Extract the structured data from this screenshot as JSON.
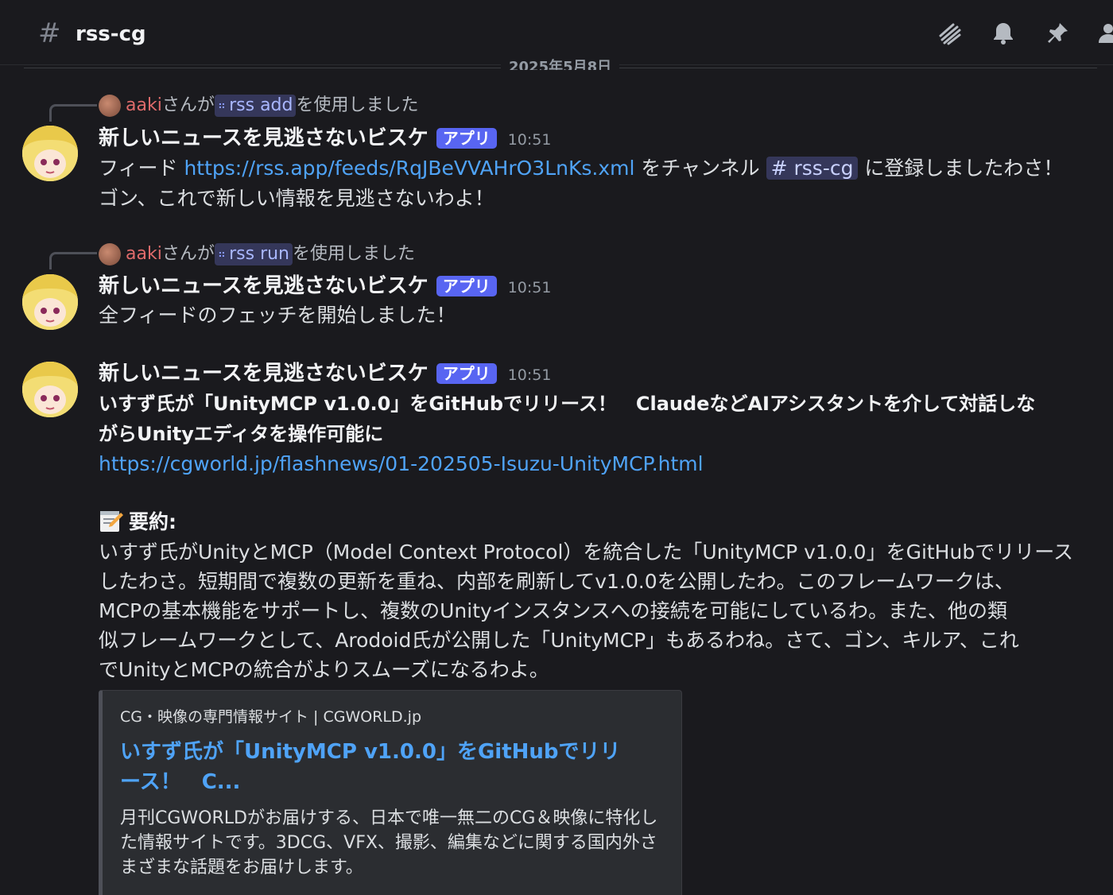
{
  "header": {
    "channel_prefix": "#",
    "channel_name": "rss-cg",
    "icons": [
      "threads-icon",
      "bell-icon",
      "pin-icon",
      "members-icon"
    ]
  },
  "date_divider": "2025年5月8日",
  "messages": [
    {
      "reply": {
        "user": "aaki",
        "middle": "さんが",
        "command": "rss add",
        "suffix": "を使用しました"
      },
      "author": "新しいニュースを見逃さないビスケ",
      "badge": "アプリ",
      "time": "10:51",
      "line1_pre": "フィード ",
      "line1_link": "https://rss.app/feeds/RqJBeVVAHrO3LnKs.xml",
      "line1_mid": " をチャンネル ",
      "line1_channel": "# rss-cg",
      "line1_post": " に登録しましたわさ！",
      "line2": "ゴン、これで新しい情報を見逃さないわよ！"
    },
    {
      "reply": {
        "user": "aaki",
        "middle": "さんが",
        "command": "rss run",
        "suffix": "を使用しました"
      },
      "author": "新しいニュースを見逃さないビスケ",
      "badge": "アプリ",
      "time": "10:51",
      "line1": "全フィードのフェッチを開始しました！"
    },
    {
      "author": "新しいニュースを見逃さないビスケ",
      "badge": "アプリ",
      "time": "10:51",
      "headline_l1": "いすず氏が「UnityMCP v1.0.0」をGitHubでリリース！　ClaudeなどAIアシスタントを介して対話しな",
      "headline_l2": "がらUnityエディタを操作可能に",
      "url": "https://cgworld.jp/flashnews/01-202505-Isuzu-UnityMCP.html",
      "summary_label": "要約:",
      "summary_lines": [
        "いすず氏がUnityとMCP（Model Context Protocol）を統合した「UnityMCP v1.0.0」をGitHubでリリース",
        "したわさ。短期間で複数の更新を重ね、内部を刷新してv1.0.0を公開したわ。このフレームワークは、",
        "MCPの基本機能をサポートし、複数のUnityインスタンスへの接続を可能にしているわ。また、他の類",
        "似フレームワークとして、Arodoid氏が公開した「UnityMCP」もあるわね。さて、ゴン、キルア、これ",
        "でUnityとMCPの統合がよりスムーズになるわよ。"
      ],
      "embed": {
        "provider": "CG・映像の専門情報サイト | CGWORLD.jp",
        "title": "いすず氏が「UnityMCP v1.0.0」をGitHubでリリース！　C...",
        "description": "月刊CGWORLDがお届けする、日本で唯一無二のCG＆映像に特化した情報サイトです。3DCG、VFX、撮影、編集などに関する国内外さまざまな話題をお届けします。"
      }
    }
  ]
}
